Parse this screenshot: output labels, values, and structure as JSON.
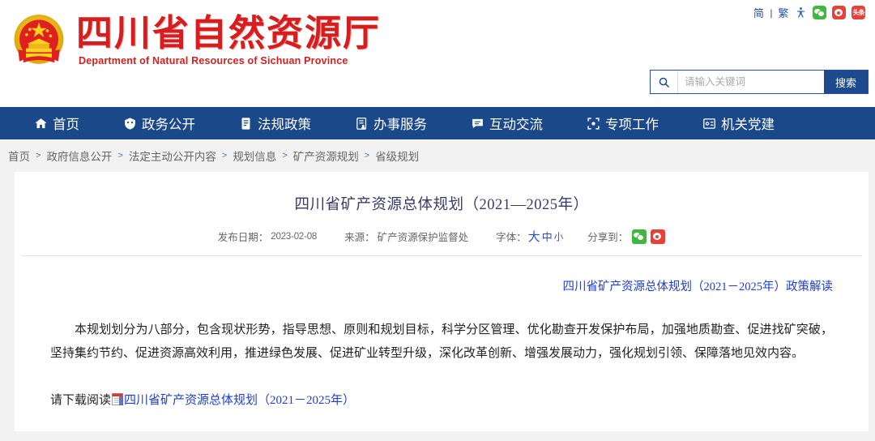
{
  "topbar": {
    "lang_simplified": "简",
    "lang_sep": "|",
    "lang_traditional": "繁",
    "icons": [
      "accessibility-icon",
      "wechat-icon",
      "weibo-icon",
      "toutiao-icon"
    ],
    "toutiao_label": "头条"
  },
  "brand": {
    "zh": "四川省自然资源厅",
    "en": "Department of Natural Resources of Sichuan Province",
    "emblem": "national-emblem",
    "color": "#d71d1d"
  },
  "search": {
    "placeholder": "请输入关键词",
    "value": "",
    "button_label": "搜索",
    "icon": "search-icon",
    "button_color": "#1d4a8f"
  },
  "nav": {
    "background": "#1a4888",
    "items": [
      {
        "label": "首页",
        "icon": "home-icon"
      },
      {
        "label": "政务公开",
        "icon": "shield-icon"
      },
      {
        "label": "法规政策",
        "icon": "document-icon"
      },
      {
        "label": "办事服务",
        "icon": "service-form-icon"
      },
      {
        "label": "互动交流",
        "icon": "chat-bubble-icon"
      },
      {
        "label": "专项工作",
        "icon": "focus-target-icon"
      },
      {
        "label": "机关党建",
        "icon": "party-badge-icon"
      }
    ]
  },
  "breadcrumb": {
    "separator": ">",
    "items": [
      "首页",
      "政府信息公开",
      "法定主动公开内容",
      "规划信息",
      "矿产资源规划",
      "省级规划"
    ]
  },
  "article": {
    "title": "四川省矿产资源总体规划（2021—2025年）",
    "meta": {
      "date_label": "发布日期：",
      "date_value": "2023-02-08",
      "source_label": "来源：",
      "source_value": "矿产资源保护监督处",
      "fontsize_label": "字体：",
      "fontsize_large": "大",
      "fontsize_medium": "中",
      "fontsize_small": "小",
      "share_label": "分享到：",
      "share_icons": [
        "wechat-icon",
        "weibo-icon"
      ]
    },
    "policy_link": "四川省矿产资源总体规划（2021－2025年）政策解读",
    "body": "本规划划分为八部分，包含现状形势，指导思想、原则和规划目标，科学分区管理、优化勘查开发保护布局，加强地质勘查、促进找矿突破，坚持集约节约、促进资源高效利用，推进绿色发展、促进矿业转型升级，深化改革创新、增强发展动力，强化规划引领、保障落地见效内容。",
    "download_prefix": "请下载阅读",
    "download_link": "四川省矿产资源总体规划（2021－2025年）",
    "download_icon": "pdf-file-icon"
  }
}
